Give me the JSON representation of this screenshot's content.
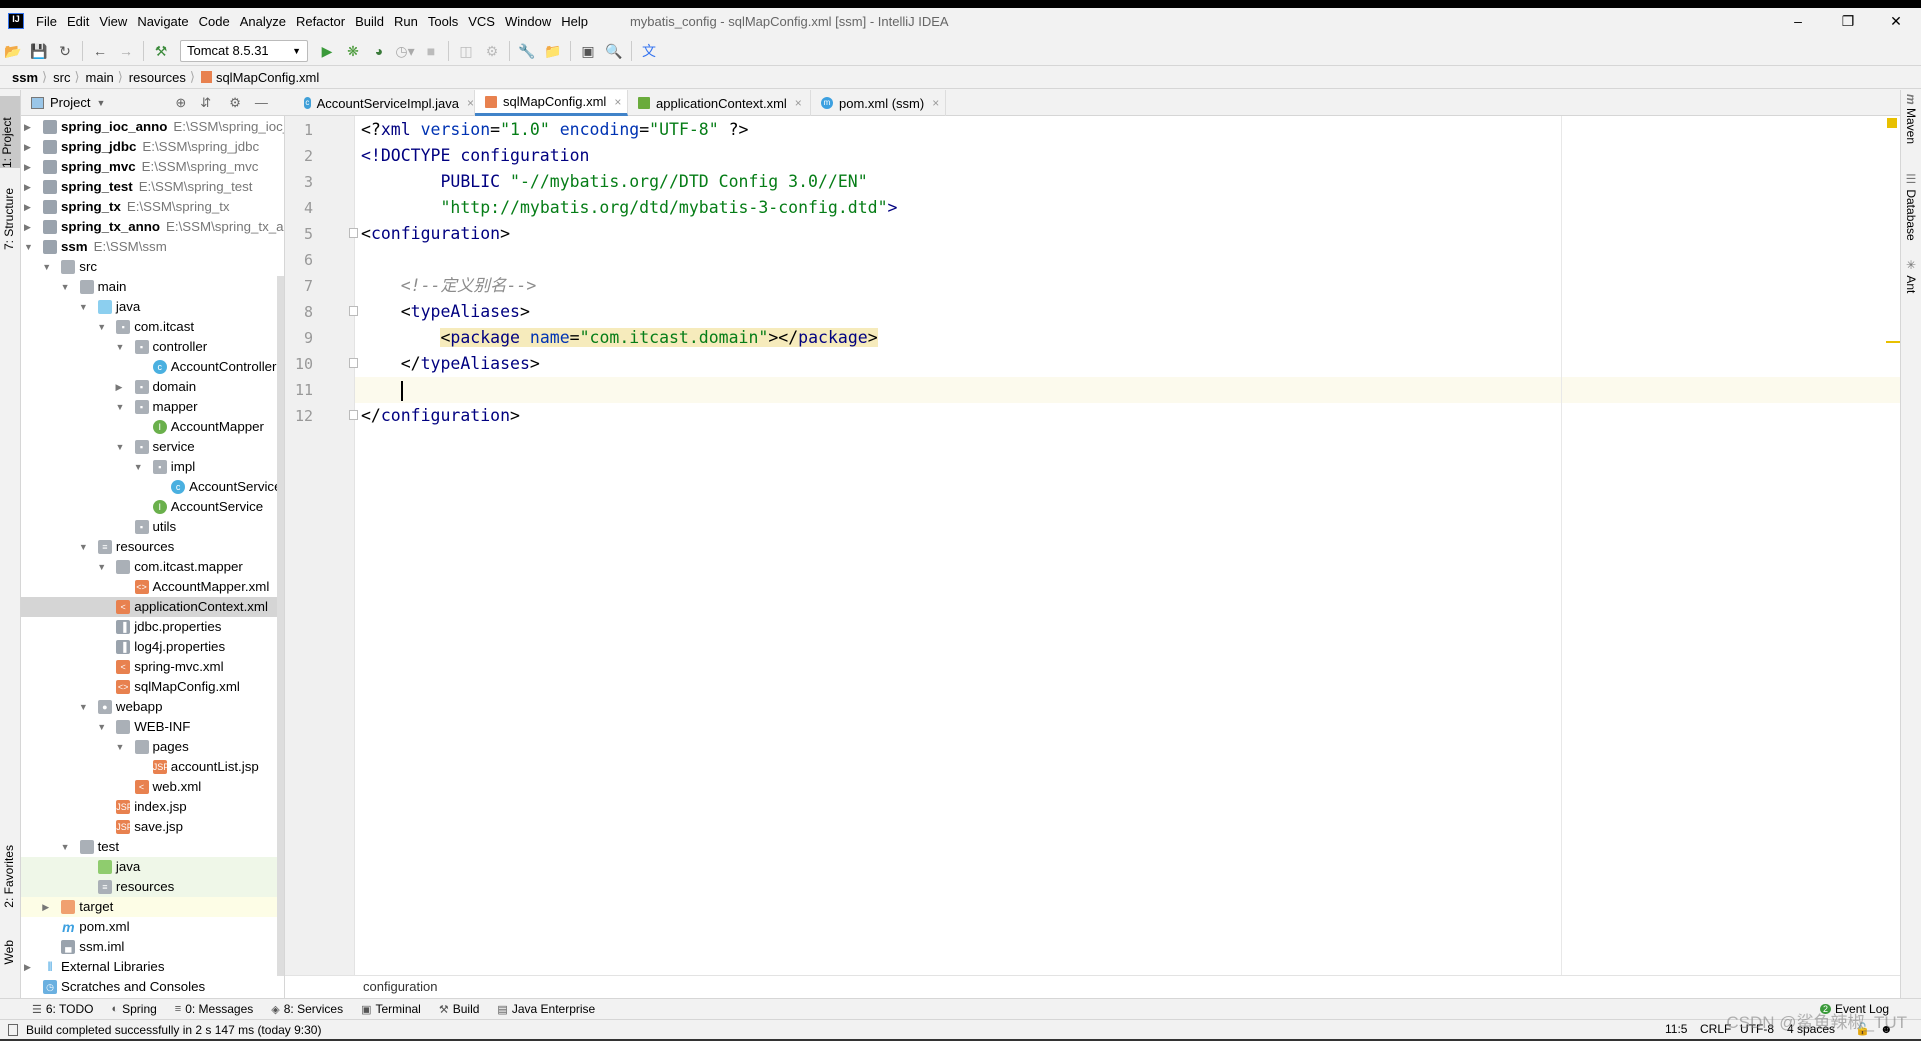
{
  "window": {
    "title": "mybatis_config - sqlMapConfig.xml [ssm] - IntelliJ IDEA",
    "logo": "IJ"
  },
  "menu": [
    "File",
    "Edit",
    "View",
    "Navigate",
    "Code",
    "Analyze",
    "Refactor",
    "Build",
    "Run",
    "Tools",
    "VCS",
    "Window",
    "Help"
  ],
  "toolbar": {
    "run_config": "Tomcat 8.5.31"
  },
  "breadcrumb": [
    "ssm",
    "src",
    "main",
    "resources",
    "sqlMapConfig.xml"
  ],
  "left_strip": [
    "1: Project",
    "7: Structure",
    "2: Favorites",
    "Web"
  ],
  "right_strip": [
    "Maven",
    "Database",
    "Ant"
  ],
  "project_panel": {
    "title": "Project"
  },
  "tree": [
    {
      "name": "spring_ioc_anno",
      "path": "E:\\SSM\\spring_ioc_anno",
      "level": 0,
      "arrow": "closed",
      "icon": "module",
      "bold": true
    },
    {
      "name": "spring_jdbc",
      "path": "E:\\SSM\\spring_jdbc",
      "level": 0,
      "arrow": "closed",
      "icon": "module",
      "bold": true
    },
    {
      "name": "spring_mvc",
      "path": "E:\\SSM\\spring_mvc",
      "level": 0,
      "arrow": "closed",
      "icon": "module",
      "bold": true
    },
    {
      "name": "spring_test",
      "path": "E:\\SSM\\spring_test",
      "level": 0,
      "arrow": "closed",
      "icon": "module",
      "bold": true
    },
    {
      "name": "spring_tx",
      "path": "E:\\SSM\\spring_tx",
      "level": 0,
      "arrow": "closed",
      "icon": "module",
      "bold": true
    },
    {
      "name": "spring_tx_anno",
      "path": "E:\\SSM\\spring_tx_anno",
      "level": 0,
      "arrow": "closed",
      "icon": "module",
      "bold": true
    },
    {
      "name": "ssm",
      "path": "E:\\SSM\\ssm",
      "level": 0,
      "arrow": "open",
      "icon": "module",
      "bold": true
    },
    {
      "name": "src",
      "level": 1,
      "arrow": "open",
      "icon": "folder"
    },
    {
      "name": "main",
      "level": 2,
      "arrow": "open",
      "icon": "folder"
    },
    {
      "name": "java",
      "level": 3,
      "arrow": "open",
      "icon": "src-folder"
    },
    {
      "name": "com.itcast",
      "level": 4,
      "arrow": "open",
      "icon": "package"
    },
    {
      "name": "controller",
      "level": 5,
      "arrow": "open",
      "icon": "package"
    },
    {
      "name": "AccountController",
      "level": 6,
      "icon": "class"
    },
    {
      "name": "domain",
      "level": 5,
      "arrow": "closed",
      "icon": "package"
    },
    {
      "name": "mapper",
      "level": 5,
      "arrow": "open",
      "icon": "package"
    },
    {
      "name": "AccountMapper",
      "level": 6,
      "icon": "interface"
    },
    {
      "name": "service",
      "level": 5,
      "arrow": "open",
      "icon": "package"
    },
    {
      "name": "impl",
      "level": 6,
      "arrow": "open",
      "icon": "package"
    },
    {
      "name": "AccountServiceImpl",
      "level": 7,
      "icon": "class"
    },
    {
      "name": "AccountService",
      "level": 6,
      "icon": "interface"
    },
    {
      "name": "utils",
      "level": 5,
      "icon": "package"
    },
    {
      "name": "resources",
      "level": 3,
      "arrow": "open",
      "icon": "res-folder"
    },
    {
      "name": "com.itcast.mapper",
      "level": 4,
      "arrow": "open",
      "icon": "folder"
    },
    {
      "name": "AccountMapper.xml",
      "level": 5,
      "icon": "xml"
    },
    {
      "name": "applicationContext.xml",
      "level": 4,
      "icon": "spring-xml",
      "state": "selected"
    },
    {
      "name": "jdbc.properties",
      "level": 4,
      "icon": "properties"
    },
    {
      "name": "log4j.properties",
      "level": 4,
      "icon": "properties"
    },
    {
      "name": "spring-mvc.xml",
      "level": 4,
      "icon": "spring-xml"
    },
    {
      "name": "sqlMapConfig.xml",
      "level": 4,
      "icon": "xml"
    },
    {
      "name": "webapp",
      "level": 3,
      "arrow": "open",
      "icon": "web-folder"
    },
    {
      "name": "WEB-INF",
      "level": 4,
      "arrow": "open",
      "icon": "folder"
    },
    {
      "name": "pages",
      "level": 5,
      "arrow": "open",
      "icon": "folder"
    },
    {
      "name": "accountList.jsp",
      "level": 6,
      "icon": "jsp"
    },
    {
      "name": "web.xml",
      "level": 5,
      "icon": "web-xml"
    },
    {
      "name": "index.jsp",
      "level": 4,
      "icon": "jsp"
    },
    {
      "name": "save.jsp",
      "level": 4,
      "icon": "jsp"
    },
    {
      "name": "test",
      "level": 2,
      "arrow": "open",
      "icon": "folder"
    },
    {
      "name": "java",
      "level": 3,
      "icon": "test-folder",
      "state": "green"
    },
    {
      "name": "resources",
      "level": 3,
      "icon": "test-res-folder",
      "state": "green"
    },
    {
      "name": "target",
      "level": 1,
      "arrow": "closed",
      "icon": "excluded-folder",
      "state": "yellow"
    },
    {
      "name": "pom.xml",
      "level": 1,
      "icon": "maven"
    },
    {
      "name": "ssm.iml",
      "level": 1,
      "icon": "iml"
    },
    {
      "name": "External Libraries",
      "level": 0,
      "arrow": "closed",
      "icon": "libraries"
    },
    {
      "name": "Scratches and Consoles",
      "level": 0,
      "icon": "scratches"
    }
  ],
  "tabs": [
    {
      "label": "AccountServiceImpl.java",
      "icon": "class",
      "color": "#40a0d8"
    },
    {
      "label": "sqlMapConfig.xml",
      "icon": "xml",
      "color": "#e8814f",
      "active": true
    },
    {
      "label": "applicationContext.xml",
      "icon": "spring-xml",
      "color": "#6aab3c"
    },
    {
      "label": "pom.xml (ssm)",
      "icon": "maven",
      "color": "#3ca0e0"
    }
  ],
  "editor": {
    "current_line": 11,
    "highlight_line": 9,
    "lines": [
      [
        [
          "k-pun",
          "<?"
        ],
        [
          "k-tag",
          "xml"
        ],
        [
          "k-pun",
          " "
        ],
        [
          "k-attr",
          "version"
        ],
        [
          "k-pun",
          "="
        ],
        [
          "k-val",
          "\"1.0\""
        ],
        [
          "k-pun",
          " "
        ],
        [
          "k-attr",
          "encoding"
        ],
        [
          "k-pun",
          "="
        ],
        [
          "k-val",
          "\"UTF-8\""
        ],
        [
          "k-pun",
          " ?>"
        ]
      ],
      [
        [
          "k-tag",
          "<!DOCTYPE configuration"
        ]
      ],
      [
        [
          "k-pun",
          "        "
        ],
        [
          "k-tag",
          "PUBLIC "
        ],
        [
          "k-val",
          "\"-//mybatis.org//DTD Config 3.0//EN\""
        ]
      ],
      [
        [
          "k-pun",
          "        "
        ],
        [
          "k-val",
          "\"http://mybatis.org/dtd/mybatis-3-config.dtd\""
        ],
        [
          "k-tag",
          ">"
        ]
      ],
      [
        [
          "k-pun",
          "<"
        ],
        [
          "k-tag",
          "configuration"
        ],
        [
          "k-pun",
          ">"
        ]
      ],
      [],
      [
        [
          "k-pun",
          "    "
        ],
        [
          "k-com",
          "<!--定义别名-->"
        ]
      ],
      [
        [
          "k-pun",
          "    <"
        ],
        [
          "k-tag",
          "typeAliases"
        ],
        [
          "k-pun",
          ">"
        ]
      ],
      [
        [
          "k-pun",
          "        "
        ],
        [
          "hl k-pun",
          "<"
        ],
        [
          "hl k-tag",
          "package "
        ],
        [
          "hl k-attr",
          "name"
        ],
        [
          "hl k-pun",
          "="
        ],
        [
          "hl k-val",
          "\"com.itcast.domain\""
        ],
        [
          "hl k-pun",
          "></"
        ],
        [
          "hl k-tag",
          "package"
        ],
        [
          "hl k-pun",
          ">"
        ]
      ],
      [
        [
          "k-pun",
          "    </"
        ],
        [
          "k-tag",
          "typeAliases"
        ],
        [
          "k-pun",
          ">"
        ]
      ],
      [
        [
          "k-pun",
          "    "
        ]
      ],
      [
        [
          "k-pun",
          "</"
        ],
        [
          "k-tag",
          "configuration"
        ],
        [
          "k-pun",
          ">"
        ]
      ]
    ],
    "breadcrumb": "configuration"
  },
  "tool_windows": [
    {
      "label": "6: TODO",
      "icon": "todo-icon"
    },
    {
      "label": "Spring",
      "icon": "spring-icon"
    },
    {
      "label": "0: Messages",
      "icon": "messages-icon"
    },
    {
      "label": "8: Services",
      "icon": "services-icon"
    },
    {
      "label": "Terminal",
      "icon": "terminal-icon"
    },
    {
      "label": "Build",
      "icon": "build-icon"
    },
    {
      "label": "Java Enterprise",
      "icon": "java-enterprise-icon"
    }
  ],
  "event_log": {
    "label": "Event Log",
    "count": "2"
  },
  "status": {
    "message": "Build completed successfully in 2 s 147 ms (today 9:30)",
    "position": "11:5",
    "line_sep": "CRLF",
    "encoding": "UTF-8",
    "indent": "4 spaces"
  },
  "watermark": "CSDN @鲨鱼辣椒_TUT"
}
